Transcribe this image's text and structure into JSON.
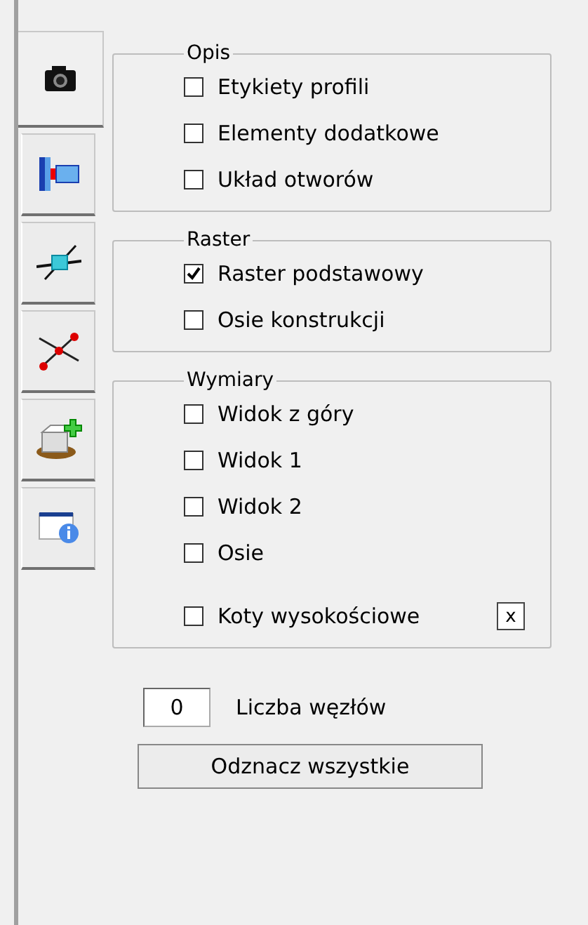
{
  "tabs": [
    {
      "kind": "camera",
      "selected": true
    },
    {
      "kind": "beam",
      "selected": false
    },
    {
      "kind": "cube",
      "selected": false
    },
    {
      "kind": "nodes",
      "selected": false
    },
    {
      "kind": "box",
      "selected": false
    },
    {
      "kind": "info",
      "selected": false
    }
  ],
  "groups": [
    {
      "title": "Opis",
      "options": [
        {
          "label": "Etykiety profili",
          "checked": false
        },
        {
          "label": "Elementy dodatkowe",
          "checked": false
        },
        {
          "label": "Układ otworów",
          "checked": false
        }
      ]
    },
    {
      "title": "Raster",
      "options": [
        {
          "label": "Raster podstawowy",
          "checked": true
        },
        {
          "label": "Osie konstrukcji",
          "checked": false
        }
      ]
    },
    {
      "title": "Wymiary",
      "options": [
        {
          "label": "Widok z góry",
          "checked": false
        },
        {
          "label": "Widok 1",
          "checked": false
        },
        {
          "label": "Widok 2",
          "checked": false
        },
        {
          "label": "Osie",
          "checked": false
        },
        {
          "label": "Koty wysokościowe",
          "checked": false,
          "button": "x"
        }
      ]
    }
  ],
  "node_count": {
    "value": "0",
    "label": "Liczba węzłów"
  },
  "clear_button": "Odznacz wszystkie"
}
